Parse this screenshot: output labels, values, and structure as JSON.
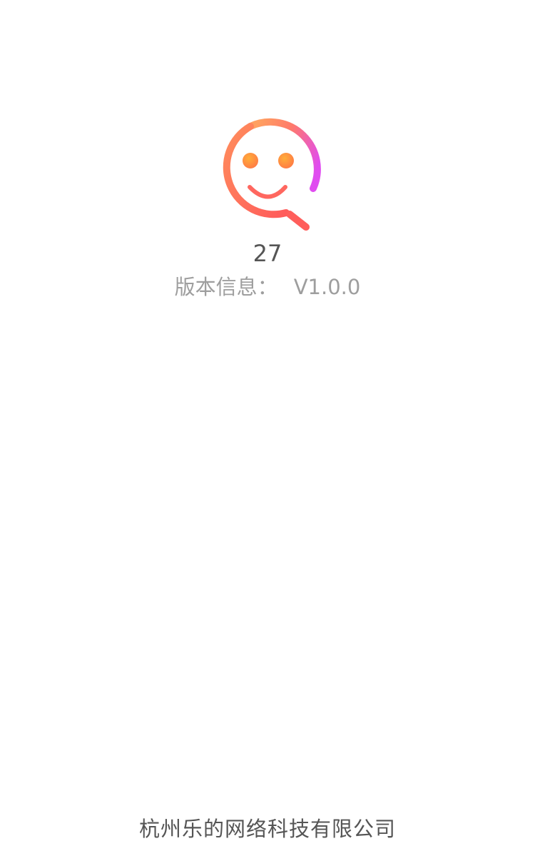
{
  "app": {
    "name": "27",
    "logo_icon": "smiley-magnifier-logo-icon"
  },
  "version": {
    "label": "版本信息：",
    "value": "V1.0.0"
  },
  "footer": {
    "company": "杭州乐的网络科技有限公司"
  },
  "colors": {
    "logo_gradient": [
      "#ff9a5c",
      "#ff6a5a",
      "#e24df0"
    ],
    "eyes": "#ff9a3c",
    "smile": "#ff6a5a",
    "title_text": "#555555",
    "version_text": "#9e9e9e",
    "footer_text": "#555555",
    "background": "#ffffff"
  }
}
